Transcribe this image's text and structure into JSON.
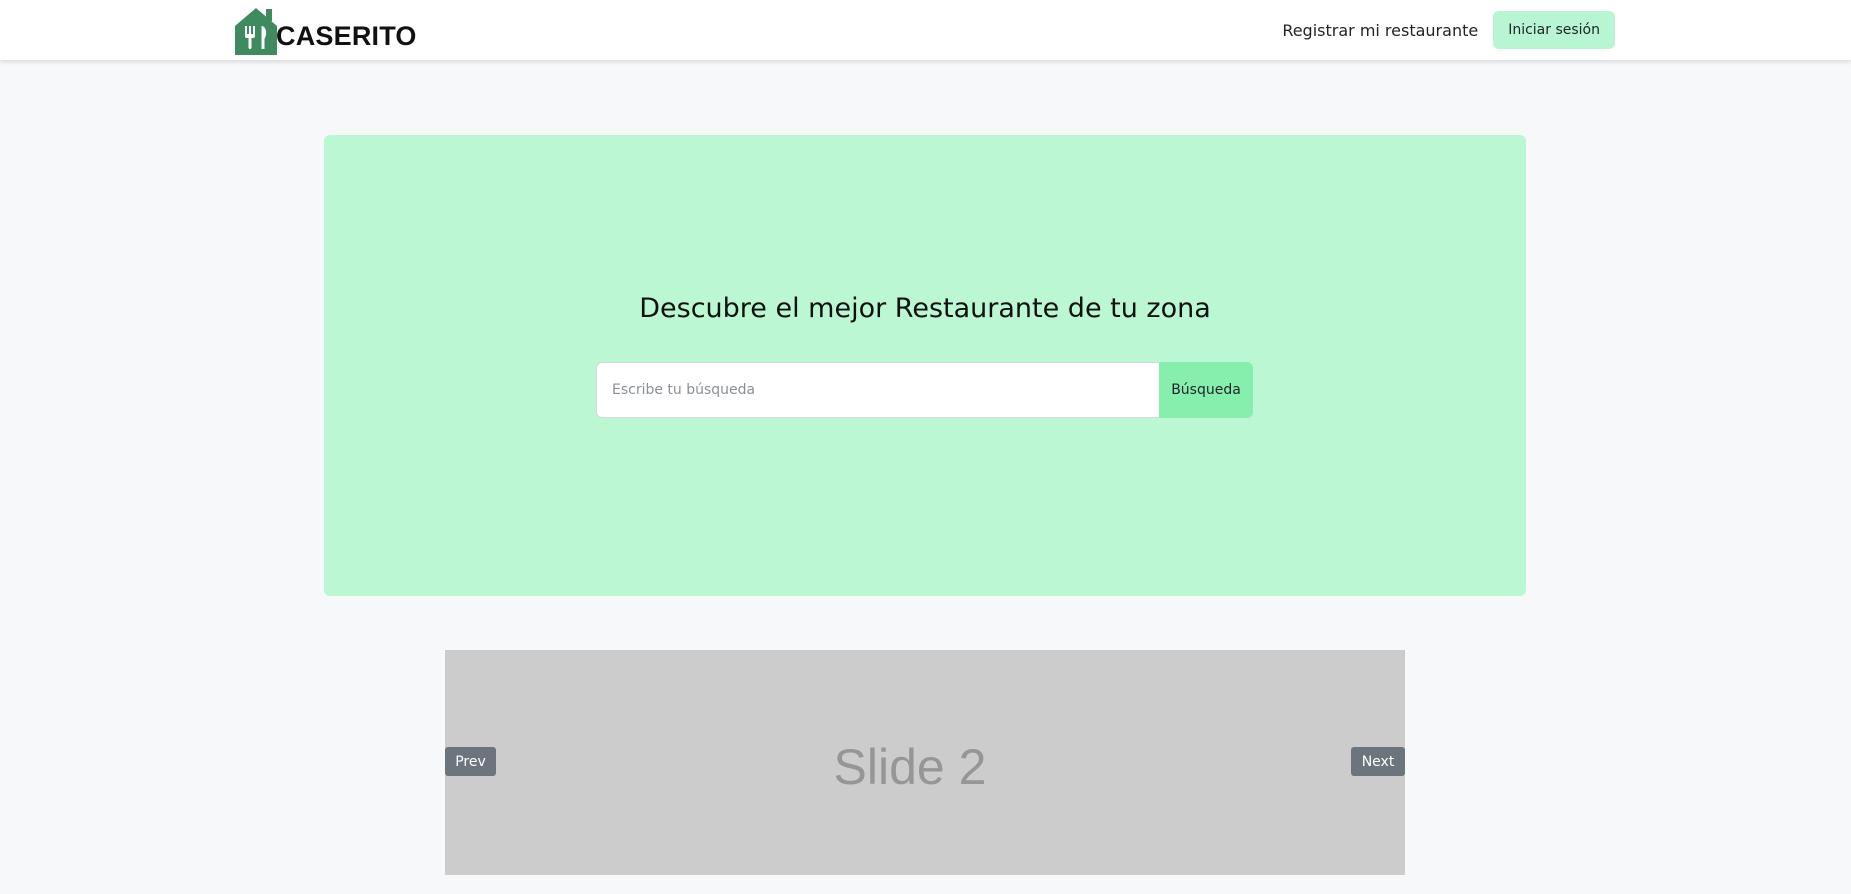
{
  "header": {
    "brand_name": "CASERITO",
    "logo_icon": "house-cutlery-icon",
    "register_link": "Registrar mi restaurante",
    "login_button": "Iniciar sesión"
  },
  "hero": {
    "title": "Descubre el mejor Restaurante de tu zona",
    "search_placeholder": "Escribe tu búsqueda",
    "search_value": "",
    "search_button": "Búsqueda"
  },
  "carousel": {
    "slide_label": "Slide 2",
    "prev_label": "Prev",
    "next_label": "Next"
  },
  "colors": {
    "brand_green": "#3f8a5e",
    "hero_background": "#baf7d2",
    "search_button": "#86efad",
    "login_button": "#b8f5d2",
    "carousel_background": "#cccccc",
    "carousel_control": "#6c757d",
    "page_background": "#f7f8fa"
  }
}
